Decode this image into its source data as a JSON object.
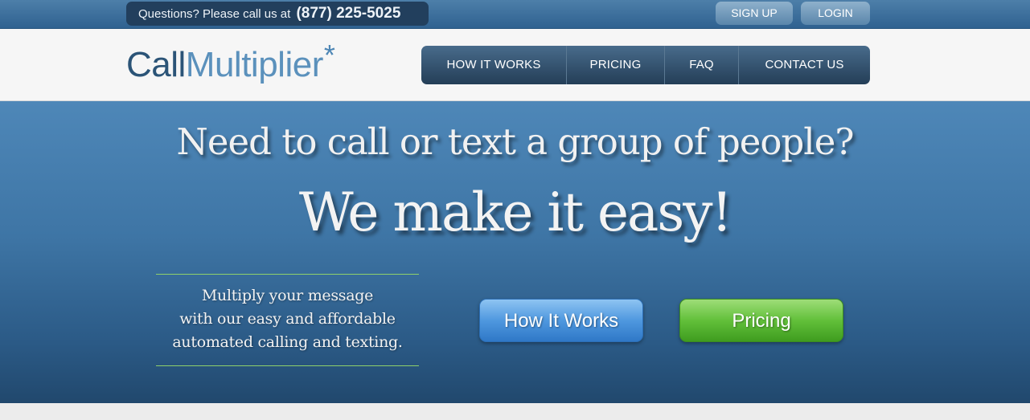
{
  "topbar": {
    "questions_text": "Questions? Please call us at",
    "phone_number": "(877) 225-5025",
    "signup_label": "SIGN UP",
    "login_label": "LOGIN"
  },
  "header": {
    "logo_call": "Call",
    "logo_multiplier": "Multiplier",
    "logo_star": "*",
    "nav": [
      {
        "label": "HOW IT WORKS"
      },
      {
        "label": "PRICING"
      },
      {
        "label": "FAQ"
      },
      {
        "label": "CONTACT US"
      }
    ]
  },
  "hero": {
    "headline": "Need to call or text a group of people?",
    "subheadline": "We make it easy!",
    "tagline": [
      "Multiply your message",
      "with our easy and affordable",
      "automated calling and texting."
    ],
    "how_it_works_label": "How It Works",
    "pricing_label": "Pricing"
  },
  "colors": {
    "topbar": "#3a6c99",
    "nav_bg": "#2f4e6c",
    "hero_bg": "#3e75a5",
    "accent_green": "#62c03a",
    "accent_blue": "#4f98df"
  }
}
